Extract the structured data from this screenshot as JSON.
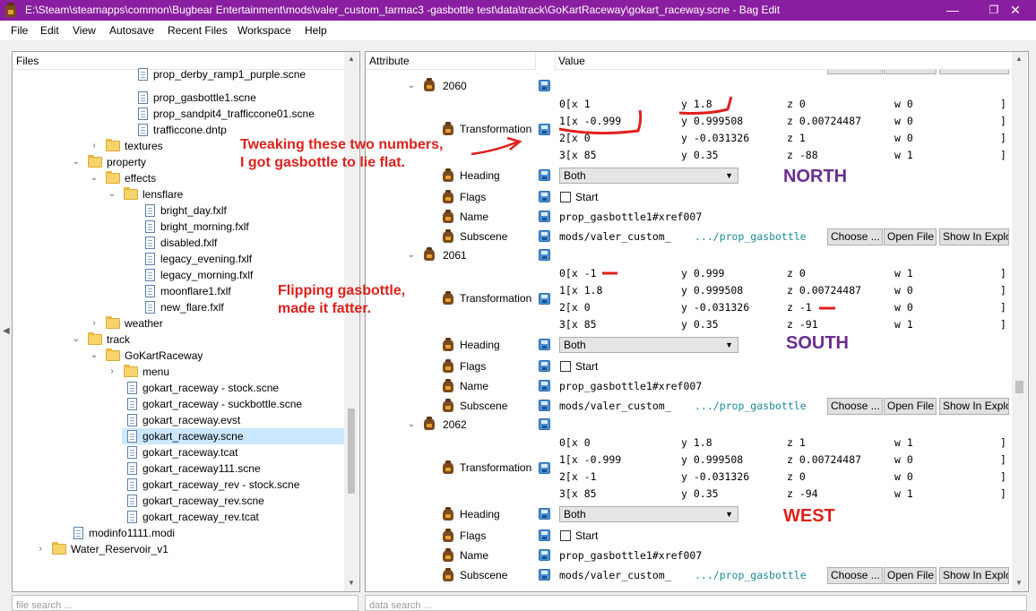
{
  "window": {
    "title": "E:\\Steam\\steamapps\\common\\Bugbear Entertainment\\mods\\valer_custom_tarmac3 -gasbottle test\\data\\track\\GoKartRaceway\\gokart_raceway.scne - Bag Edit",
    "minimize": "—",
    "maximize": "❐",
    "close": "✕"
  },
  "menu": [
    "File",
    "Edit",
    "View",
    "Autosave",
    "Recent Files",
    "Workspace",
    "Help"
  ],
  "left": {
    "header": "Files",
    "items": [
      "prop_derby_ramp1_purple.scne",
      "prop_gasbottle1.scne",
      "prop_sandpit4_trafficcone01.scne",
      "trafficcone.dntp",
      "textures",
      "property",
      "effects",
      "lensflare",
      "bright_day.fxlf",
      "bright_morning.fxlf",
      "disabled.fxlf",
      "legacy_evening.fxlf",
      "legacy_morning.fxlf",
      "moonflare1.fxlf",
      "new_flare.fxlf",
      "weather",
      "track",
      "GoKartRaceway",
      "menu",
      "gokart_raceway - stock.scne",
      "gokart_raceway - suckbottle.scne",
      "gokart_raceway.evst",
      "gokart_raceway.scne",
      "gokart_raceway.tcat",
      "gokart_raceway111.scne",
      "gokart_raceway_rev - stock.scne",
      "gokart_raceway_rev.scne",
      "gokart_raceway_rev.tcat",
      "modinfo1111.modi",
      "Water_Reservoir_v1"
    ],
    "search_placeholder": "file search ..."
  },
  "right": {
    "col_attribute": "Attribute",
    "col_value": "Value",
    "search_placeholder": "data search ...",
    "labels": {
      "transformation": "Transformation",
      "heading": "Heading",
      "flags": "Flags",
      "name": "Name",
      "subscene": "Subscene",
      "start": "Start",
      "choose": "Choose ...",
      "open_file": "Open File",
      "show_in_explorer": "Show In Explorer"
    },
    "nodes": [
      {
        "id": "2060",
        "matrix": [
          [
            "0[x 1",
            "y 1.8",
            "z 0",
            "w 0",
            "]"
          ],
          [
            "1[x -0.999",
            "y 0.999508",
            "z 0.00724487",
            "w 0",
            "]"
          ],
          [
            "2[x 0",
            "y -0.031326",
            "z 1",
            "w 0",
            "]"
          ],
          [
            "3[x 85",
            "y 0.35",
            "z -88",
            "w 1",
            "]"
          ]
        ],
        "heading": "Both",
        "name": "prop_gasbottle1#xref007",
        "subscene_a": "mods/valer_custom_",
        "subscene_b": ".../prop_gasbottle"
      },
      {
        "id": "2061",
        "matrix": [
          [
            "0[x -1",
            "y 0.999",
            "z 0",
            "w 1",
            "]"
          ],
          [
            "1[x 1.8",
            "y 0.999508",
            "z 0.00724487",
            "w 0",
            "]"
          ],
          [
            "2[x 0",
            "y -0.031326",
            "z -1",
            "w 0",
            "]"
          ],
          [
            "3[x 85",
            "y 0.35",
            "z -91",
            "w 1",
            "]"
          ]
        ],
        "heading": "Both",
        "name": "prop_gasbottle1#xref007",
        "subscene_a": "mods/valer_custom_",
        "subscene_b": ".../prop_gasbottle"
      },
      {
        "id": "2062",
        "matrix": [
          [
            "0[x 0",
            "y 1.8",
            "z 1",
            "w 1",
            "]"
          ],
          [
            "1[x -0.999",
            "y 0.999508",
            "z 0.00724487",
            "w 0",
            "]"
          ],
          [
            "2[x -1",
            "y -0.031326",
            "z 0",
            "w 0",
            "]"
          ],
          [
            "3[x 85",
            "y 0.35",
            "z -94",
            "w 1",
            "]"
          ]
        ],
        "heading": "Both",
        "name": "prop_gasbottle1#xref007",
        "subscene_a": "mods/valer_custom_",
        "subscene_b": ".../prop_gasbottle"
      }
    ]
  },
  "annotations": {
    "note1_line1": "Tweaking these two numbers,",
    "note1_line2": "I got gasbottle to lie flat.",
    "note2_line1": "Flipping gasbottle,",
    "note2_line2": "made it fatter.",
    "north": "NORTH",
    "south": "SOUTH",
    "west": "WEST"
  },
  "colors": {
    "titlebar": "#8a1ea0",
    "annotation": "#e0201c",
    "direction": "#6a2c91",
    "selection": "#cce8ff",
    "subscene_path": "#1a8a9a"
  }
}
